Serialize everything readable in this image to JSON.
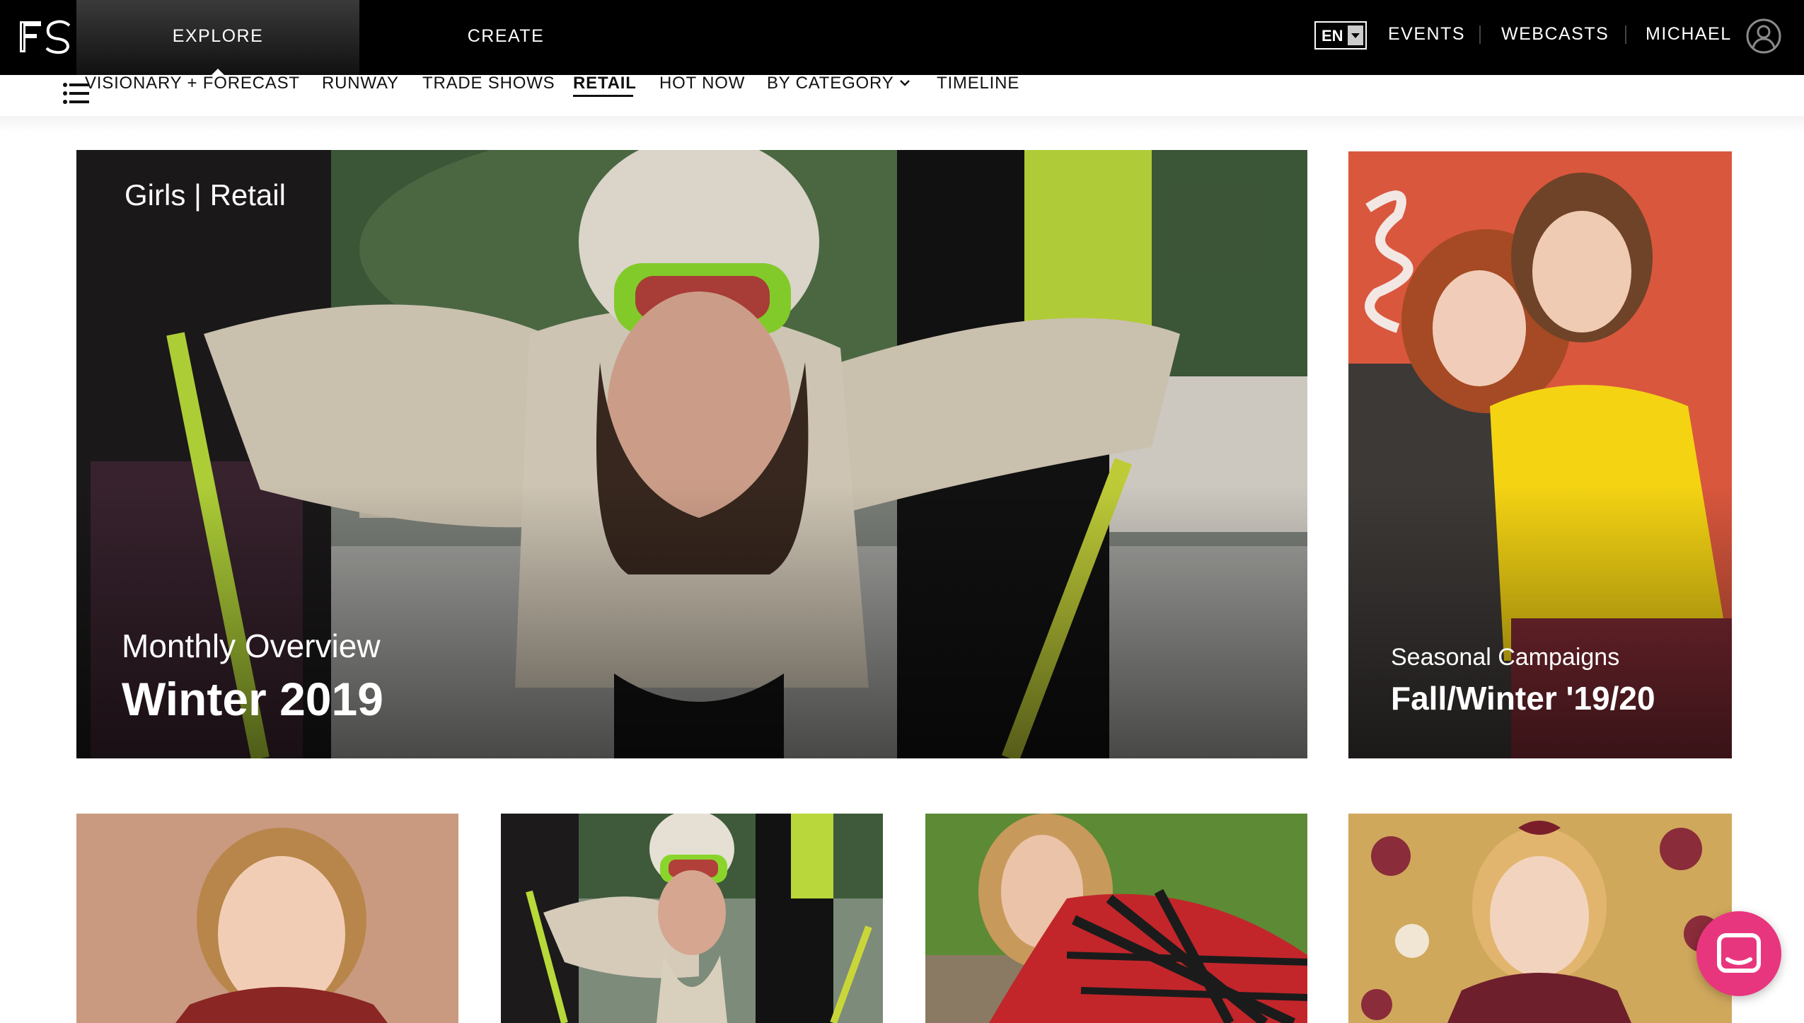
{
  "header": {
    "logo_text": "FS",
    "tabs": [
      {
        "label": "EXPLORE"
      },
      {
        "label": "CREATE"
      }
    ],
    "language": "EN",
    "links": [
      {
        "label": "EVENTS"
      },
      {
        "label": "WEBCASTS"
      }
    ],
    "user_name": "MICHAEL"
  },
  "subnav": {
    "items": [
      {
        "label": "VISIONARY + FORECAST"
      },
      {
        "label": "RUNWAY"
      },
      {
        "label": "TRADE SHOWS"
      },
      {
        "label": "RETAIL",
        "active": true
      },
      {
        "label": "HOT NOW"
      },
      {
        "label": "BY CATEGORY",
        "dropdown": true
      },
      {
        "label": "TIMELINE"
      }
    ]
  },
  "hero": {
    "tag": "Girls | Retail",
    "subtitle": "Monthly Overview",
    "title": "Winter 2019"
  },
  "side_card": {
    "subtitle": "Seasonal Campaigns",
    "title": "Fall/Winter '19/20"
  },
  "thumbnails": [
    {
      "id": "toddler-portrait"
    },
    {
      "id": "ski-girl-small"
    },
    {
      "id": "plaid-jacket-girl"
    },
    {
      "id": "floral-wallpaper-toddler"
    }
  ],
  "icons": {
    "menu": "menu-icon",
    "user": "user-icon",
    "chat": "chat-icon",
    "dropdown": "chevron-down-icon"
  },
  "colors": {
    "topbar": "#000000",
    "accent_chat": "#e8367e",
    "ski_green": "#9ad832",
    "sweater_yellow": "#f4d313",
    "side_bg": "#d9573d"
  }
}
